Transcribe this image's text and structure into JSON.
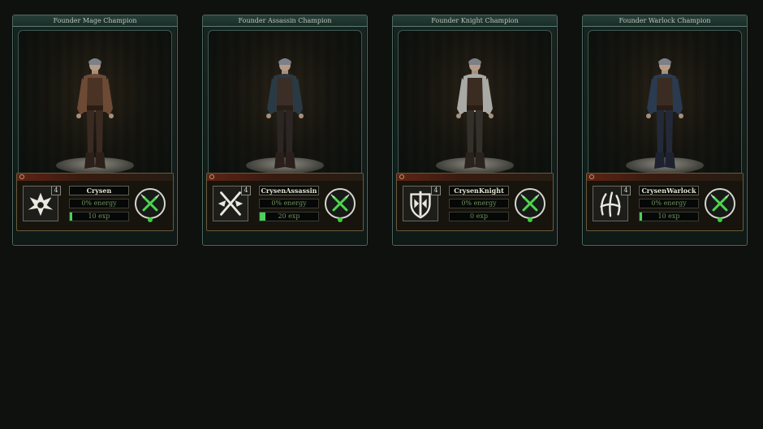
{
  "cards": [
    {
      "title": "Founder Mage Champion",
      "level": "4",
      "name": "Crysen",
      "energy": "0% energy",
      "exp_text": "10 exp",
      "exp_progress": 0.04,
      "class_icon": "mage-crest-icon",
      "outfit": {
        "coat": "#6d4a36",
        "vest": "#4a3324",
        "pants": "#3a2a22",
        "boots": "#2c211a"
      }
    },
    {
      "title": "Founder Assassin Champion",
      "level": "4",
      "name": "CrysenAssassin",
      "energy": "0% energy",
      "exp_text": "20 exp",
      "exp_progress": 0.1,
      "class_icon": "crossed-daggers-icon",
      "outfit": {
        "coat": "#2a3a44",
        "vest": "#3a2e26",
        "pants": "#2b2624",
        "boots": "#2a1f1a"
      }
    },
    {
      "title": "Founder Knight Champion",
      "level": "4",
      "name": "CrysenKnight",
      "energy": "0% energy",
      "exp_text": "0 exp",
      "exp_progress": 0,
      "class_icon": "knight-shield-icon",
      "outfit": {
        "coat": "#a9a9a6",
        "vest": "#3b2c22",
        "pants": "#33302c",
        "boots": "#2a221c"
      }
    },
    {
      "title": "Founder Warlock Champion",
      "level": "4",
      "name": "CrysenWarlock",
      "energy": "0% energy",
      "exp_text": "10 exp",
      "exp_progress": 0.04,
      "class_icon": "warlock-claw-icon",
      "outfit": {
        "coat": "#2a3a50",
        "vest": "#3a2c22",
        "pants": "#222a3a",
        "boots": "#1e2230"
      }
    }
  ],
  "colors": {
    "energy_text": "#6f8f5a",
    "exp_bar": "#4bd05c",
    "status_dot": "#3fd03f"
  }
}
